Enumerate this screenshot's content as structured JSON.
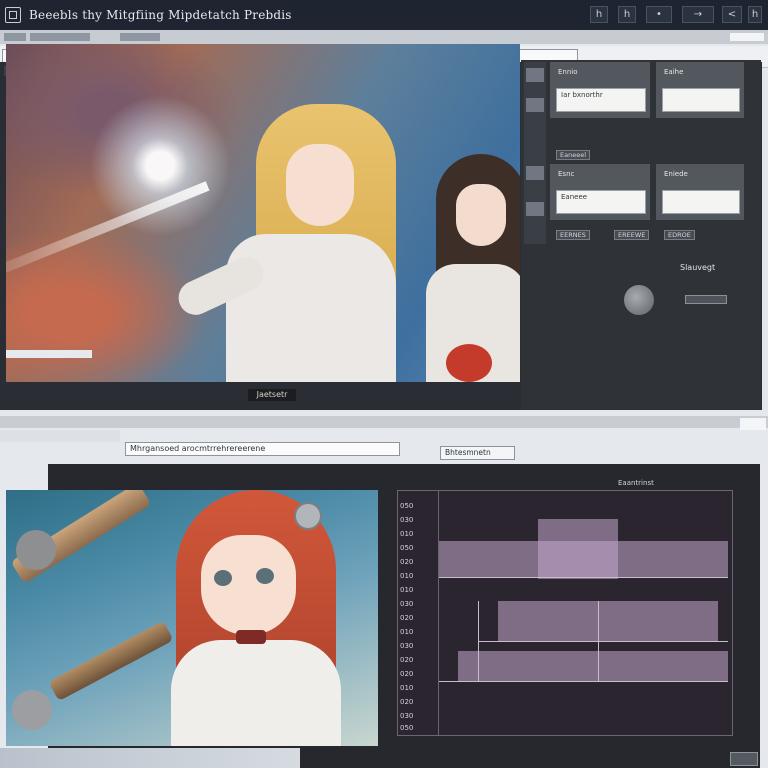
{
  "window": {
    "title": "Beeebls thy Mitgfiing Mipdetatch Prebdis",
    "title_buttons": [
      "h",
      "h",
      "•",
      "→",
      "<",
      "h"
    ]
  },
  "top_window": {
    "toolbar_fields": [
      "",
      "",
      ""
    ],
    "canvas_label": "Jaetsetr"
  },
  "right_panel": {
    "card1_title": "Ennio",
    "card1_field": "Iar bxnorthr",
    "card2_title": "Eaihe",
    "card3_title": "Esnc",
    "card3_field": "Eaneee",
    "card4_title": "Eniede",
    "chips": [
      "Eaneeel",
      "EERNES",
      "EREEWE",
      "EDROE"
    ],
    "side_label": "Slauvegt"
  },
  "bottom_window": {
    "address": "Mhrgansoed arocmtrrehrereerene",
    "tab": "Bhtesmnetn",
    "plot_title": "Eaantrinst"
  },
  "plot": {
    "ticks": [
      "050",
      "030",
      "010",
      "050",
      "020",
      "010",
      "010",
      "030",
      "020",
      "010",
      "030",
      "020",
      "020",
      "010",
      "020",
      "030",
      "050"
    ]
  }
}
